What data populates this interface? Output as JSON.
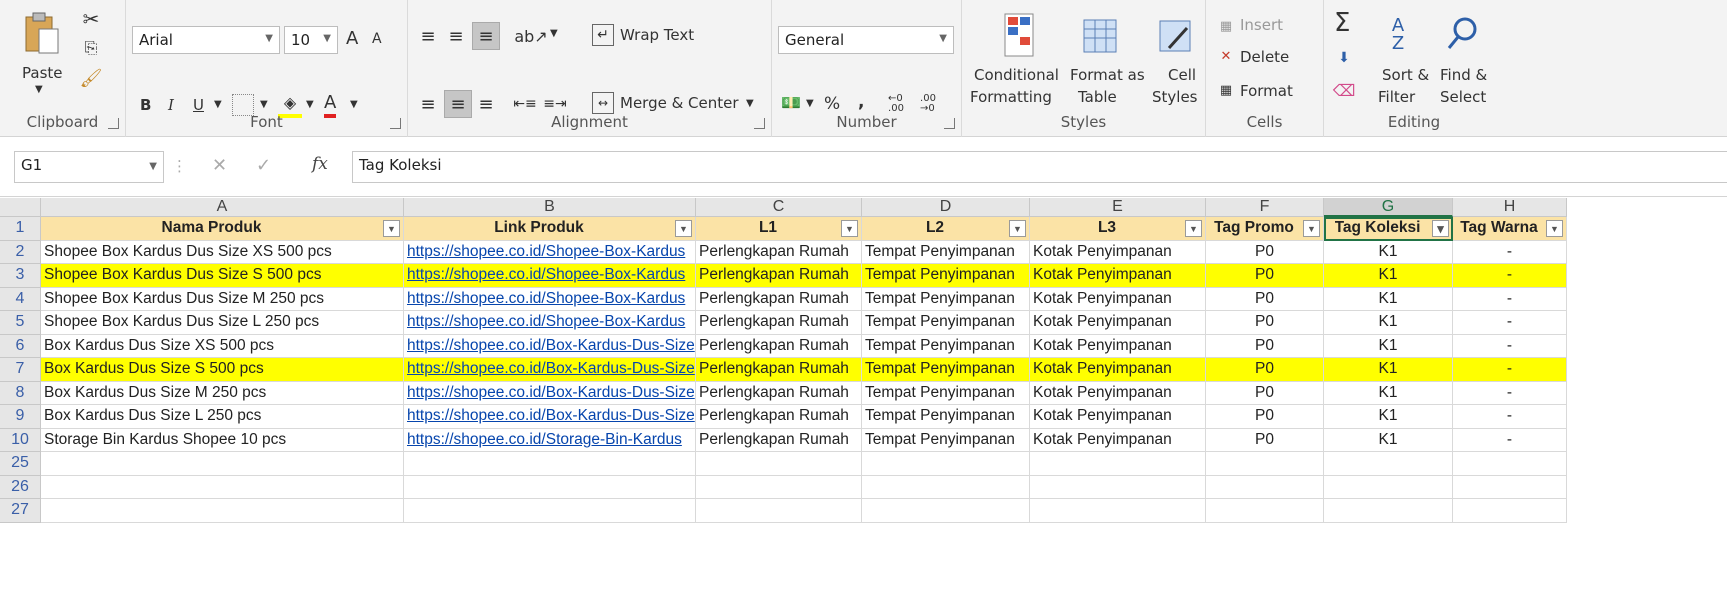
{
  "ribbon": {
    "clipboard": {
      "label": "Clipboard",
      "paste": "Paste"
    },
    "font": {
      "label": "Font",
      "name": "Arial",
      "size": "10",
      "bold": "B",
      "italic": "I",
      "underline": "U",
      "grow": "A",
      "shrink": "A",
      "font_color": "A"
    },
    "alignment": {
      "label": "Alignment",
      "wrap_text": "Wrap Text",
      "merge_center": "Merge & Center"
    },
    "number": {
      "label": "Number",
      "format": "General",
      "percent": "%",
      "comma": ","
    },
    "styles": {
      "label": "Styles",
      "conditional_1": "Conditional",
      "conditional_2": "Formatting",
      "format_table_1": "Format as",
      "format_table_2": "Table",
      "cell_styles_1": "Cell",
      "cell_styles_2": "Styles"
    },
    "cells": {
      "label": "Cells",
      "insert": "Insert",
      "delete": "Delete",
      "format": "Format"
    },
    "editing": {
      "label": "Editing",
      "sum": "Σ",
      "sort_1": "Sort &",
      "sort_2": "Filter",
      "find_1": "Find &",
      "find_2": "Select"
    }
  },
  "formula_bar": {
    "name_box": "G1",
    "fx": "fx",
    "content": "Tag Koleksi"
  },
  "columns": [
    "A",
    "B",
    "C",
    "D",
    "E",
    "F",
    "G",
    "H"
  ],
  "selected_column": "G",
  "header_row": {
    "row_number": "1",
    "cells": [
      "Nama Produk",
      "Link Produk",
      "L1",
      "L2",
      "L3",
      "Tag Promo",
      "Tag Koleksi",
      "Tag Warna"
    ]
  },
  "rows": [
    {
      "num": "2",
      "highlight": false,
      "cells": [
        "Shopee Box Kardus Dus Size XS 500 pcs",
        "https://shopee.co.id/Shopee-Box-Kardus",
        "Perlengkapan Rumah",
        "Tempat Penyimpanan",
        "Kotak Penyimpanan",
        "P0",
        "K1",
        "-"
      ]
    },
    {
      "num": "3",
      "highlight": true,
      "cells": [
        "Shopee Box Kardus Dus Size S 500 pcs",
        "https://shopee.co.id/Shopee-Box-Kardus",
        "Perlengkapan Rumah",
        "Tempat Penyimpanan",
        "Kotak Penyimpanan",
        "P0",
        "K1",
        "-"
      ]
    },
    {
      "num": "4",
      "highlight": false,
      "cells": [
        "Shopee Box Kardus Dus Size M 250 pcs",
        "https://shopee.co.id/Shopee-Box-Kardus",
        "Perlengkapan Rumah",
        "Tempat Penyimpanan",
        "Kotak Penyimpanan",
        "P0",
        "K1",
        "-"
      ]
    },
    {
      "num": "5",
      "highlight": false,
      "cells": [
        "Shopee Box Kardus Dus Size L 250 pcs",
        "https://shopee.co.id/Shopee-Box-Kardus",
        "Perlengkapan Rumah",
        "Tempat Penyimpanan",
        "Kotak Penyimpanan",
        "P0",
        "K1",
        "-"
      ]
    },
    {
      "num": "6",
      "highlight": false,
      "cells": [
        "Box Kardus Dus Size XS 500 pcs",
        "https://shopee.co.id/Box-Kardus-Dus-Size",
        "Perlengkapan Rumah",
        "Tempat Penyimpanan",
        "Kotak Penyimpanan",
        "P0",
        "K1",
        "-"
      ]
    },
    {
      "num": "7",
      "highlight": true,
      "cells": [
        "Box Kardus Dus Size S 500 pcs",
        "https://shopee.co.id/Box-Kardus-Dus-Size",
        "Perlengkapan Rumah",
        "Tempat Penyimpanan",
        "Kotak Penyimpanan",
        "P0",
        "K1",
        "-"
      ]
    },
    {
      "num": "8",
      "highlight": false,
      "cells": [
        "Box Kardus Dus Size M 250 pcs",
        "https://shopee.co.id/Box-Kardus-Dus-Size",
        "Perlengkapan Rumah",
        "Tempat Penyimpanan",
        "Kotak Penyimpanan",
        "P0",
        "K1",
        "-"
      ]
    },
    {
      "num": "9",
      "highlight": false,
      "cells": [
        "Box Kardus Dus Size L 250 pcs",
        "https://shopee.co.id/Box-Kardus-Dus-Size",
        "Perlengkapan Rumah",
        "Tempat Penyimpanan",
        "Kotak Penyimpanan",
        "P0",
        "K1",
        "-"
      ]
    },
    {
      "num": "10",
      "highlight": false,
      "cells": [
        "Storage Bin Kardus Shopee 10 pcs",
        "https://shopee.co.id/Storage-Bin-Kardus",
        "Perlengkapan Rumah",
        "Tempat Penyimpanan",
        "Kotak Penyimpanan",
        "P0",
        "K1",
        "-"
      ]
    }
  ],
  "empty_rows": [
    "25",
    "26",
    "27"
  ],
  "colors": {
    "header_fill": "#fbe3a6",
    "highlight": "#ffff00",
    "link": "#0645ad",
    "accent": "#217346"
  }
}
